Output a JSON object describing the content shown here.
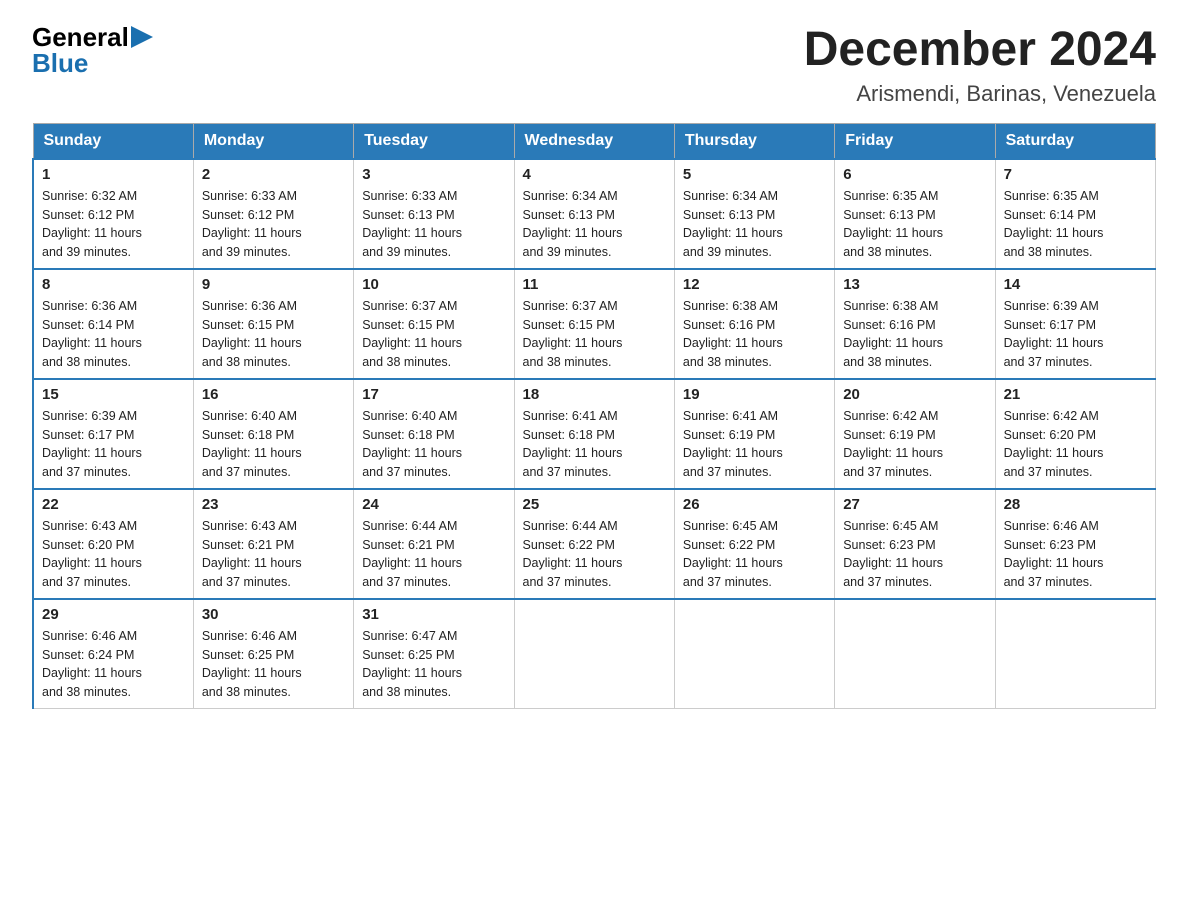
{
  "logo": {
    "general": "General",
    "blue": "Blue"
  },
  "title": "December 2024",
  "subtitle": "Arismendi, Barinas, Venezuela",
  "days_of_week": [
    "Sunday",
    "Monday",
    "Tuesday",
    "Wednesday",
    "Thursday",
    "Friday",
    "Saturday"
  ],
  "weeks": [
    [
      {
        "day": "1",
        "sunrise": "6:32 AM",
        "sunset": "6:12 PM",
        "daylight": "11 hours and 39 minutes."
      },
      {
        "day": "2",
        "sunrise": "6:33 AM",
        "sunset": "6:12 PM",
        "daylight": "11 hours and 39 minutes."
      },
      {
        "day": "3",
        "sunrise": "6:33 AM",
        "sunset": "6:13 PM",
        "daylight": "11 hours and 39 minutes."
      },
      {
        "day": "4",
        "sunrise": "6:34 AM",
        "sunset": "6:13 PM",
        "daylight": "11 hours and 39 minutes."
      },
      {
        "day": "5",
        "sunrise": "6:34 AM",
        "sunset": "6:13 PM",
        "daylight": "11 hours and 39 minutes."
      },
      {
        "day": "6",
        "sunrise": "6:35 AM",
        "sunset": "6:13 PM",
        "daylight": "11 hours and 38 minutes."
      },
      {
        "day": "7",
        "sunrise": "6:35 AM",
        "sunset": "6:14 PM",
        "daylight": "11 hours and 38 minutes."
      }
    ],
    [
      {
        "day": "8",
        "sunrise": "6:36 AM",
        "sunset": "6:14 PM",
        "daylight": "11 hours and 38 minutes."
      },
      {
        "day": "9",
        "sunrise": "6:36 AM",
        "sunset": "6:15 PM",
        "daylight": "11 hours and 38 minutes."
      },
      {
        "day": "10",
        "sunrise": "6:37 AM",
        "sunset": "6:15 PM",
        "daylight": "11 hours and 38 minutes."
      },
      {
        "day": "11",
        "sunrise": "6:37 AM",
        "sunset": "6:15 PM",
        "daylight": "11 hours and 38 minutes."
      },
      {
        "day": "12",
        "sunrise": "6:38 AM",
        "sunset": "6:16 PM",
        "daylight": "11 hours and 38 minutes."
      },
      {
        "day": "13",
        "sunrise": "6:38 AM",
        "sunset": "6:16 PM",
        "daylight": "11 hours and 38 minutes."
      },
      {
        "day": "14",
        "sunrise": "6:39 AM",
        "sunset": "6:17 PM",
        "daylight": "11 hours and 37 minutes."
      }
    ],
    [
      {
        "day": "15",
        "sunrise": "6:39 AM",
        "sunset": "6:17 PM",
        "daylight": "11 hours and 37 minutes."
      },
      {
        "day": "16",
        "sunrise": "6:40 AM",
        "sunset": "6:18 PM",
        "daylight": "11 hours and 37 minutes."
      },
      {
        "day": "17",
        "sunrise": "6:40 AM",
        "sunset": "6:18 PM",
        "daylight": "11 hours and 37 minutes."
      },
      {
        "day": "18",
        "sunrise": "6:41 AM",
        "sunset": "6:18 PM",
        "daylight": "11 hours and 37 minutes."
      },
      {
        "day": "19",
        "sunrise": "6:41 AM",
        "sunset": "6:19 PM",
        "daylight": "11 hours and 37 minutes."
      },
      {
        "day": "20",
        "sunrise": "6:42 AM",
        "sunset": "6:19 PM",
        "daylight": "11 hours and 37 minutes."
      },
      {
        "day": "21",
        "sunrise": "6:42 AM",
        "sunset": "6:20 PM",
        "daylight": "11 hours and 37 minutes."
      }
    ],
    [
      {
        "day": "22",
        "sunrise": "6:43 AM",
        "sunset": "6:20 PM",
        "daylight": "11 hours and 37 minutes."
      },
      {
        "day": "23",
        "sunrise": "6:43 AM",
        "sunset": "6:21 PM",
        "daylight": "11 hours and 37 minutes."
      },
      {
        "day": "24",
        "sunrise": "6:44 AM",
        "sunset": "6:21 PM",
        "daylight": "11 hours and 37 minutes."
      },
      {
        "day": "25",
        "sunrise": "6:44 AM",
        "sunset": "6:22 PM",
        "daylight": "11 hours and 37 minutes."
      },
      {
        "day": "26",
        "sunrise": "6:45 AM",
        "sunset": "6:22 PM",
        "daylight": "11 hours and 37 minutes."
      },
      {
        "day": "27",
        "sunrise": "6:45 AM",
        "sunset": "6:23 PM",
        "daylight": "11 hours and 37 minutes."
      },
      {
        "day": "28",
        "sunrise": "6:46 AM",
        "sunset": "6:23 PM",
        "daylight": "11 hours and 37 minutes."
      }
    ],
    [
      {
        "day": "29",
        "sunrise": "6:46 AM",
        "sunset": "6:24 PM",
        "daylight": "11 hours and 38 minutes."
      },
      {
        "day": "30",
        "sunrise": "6:46 AM",
        "sunset": "6:25 PM",
        "daylight": "11 hours and 38 minutes."
      },
      {
        "day": "31",
        "sunrise": "6:47 AM",
        "sunset": "6:25 PM",
        "daylight": "11 hours and 38 minutes."
      },
      null,
      null,
      null,
      null
    ]
  ],
  "labels": {
    "sunrise": "Sunrise:",
    "sunset": "Sunset:",
    "daylight": "Daylight:"
  }
}
